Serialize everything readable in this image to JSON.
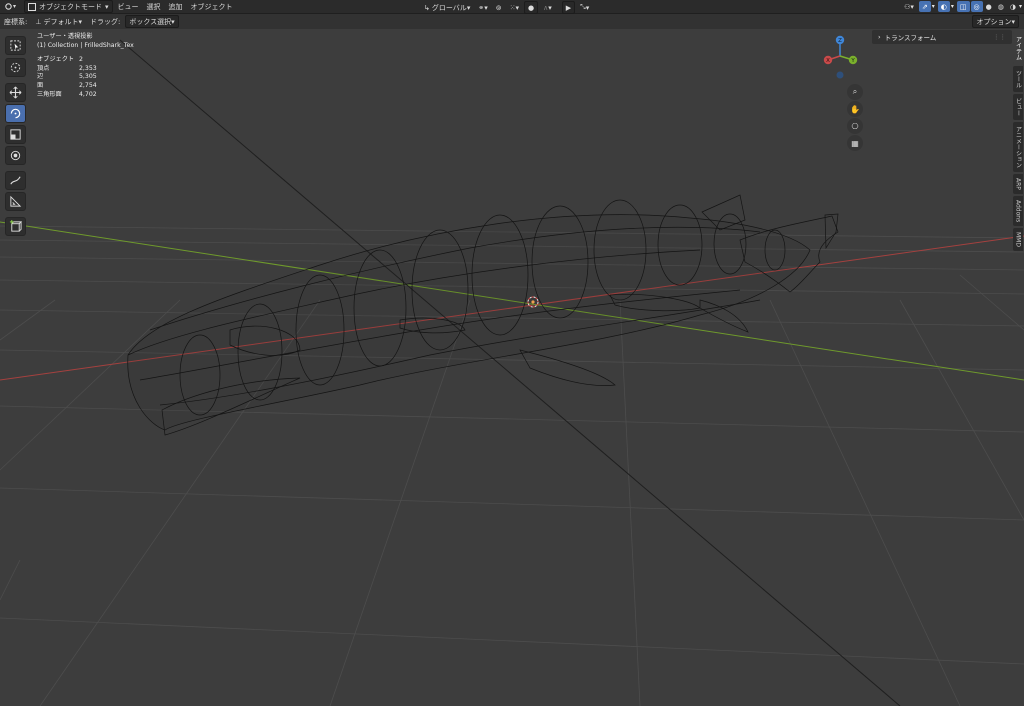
{
  "header": {
    "mode": "オブジェクトモード",
    "menus": [
      "ビュー",
      "選択",
      "追加",
      "オブジェクト"
    ],
    "transform_orientation": "グローバル"
  },
  "subheader": {
    "orientation_label": "座標系:",
    "orientation_value": "デフォルト",
    "drag_label": "ドラッグ:",
    "drag_value": "ボックス選択",
    "options": "オプション"
  },
  "overlay": {
    "view_name": "ユーザー・透視投影",
    "collection": "(1) Collection | FrilledShark_Tex",
    "stats": [
      {
        "label": "オブジェクト",
        "value": "2"
      },
      {
        "label": "頂点",
        "value": "2,353"
      },
      {
        "label": "辺",
        "value": "5,305"
      },
      {
        "label": "面",
        "value": "2,754"
      },
      {
        "label": "三角形面",
        "value": "4,702"
      }
    ]
  },
  "gizmo": {
    "x": "X",
    "y": "Y",
    "z": "Z"
  },
  "n_panel": {
    "transform_header": "トランスフォーム",
    "tabs": [
      "アイテム",
      "ツール",
      "ビュー",
      "アニメーション",
      "ARP",
      "Addons",
      "MMD"
    ]
  },
  "colors": {
    "x_axis": "#c94a4a",
    "y_axis": "#7ab02c",
    "z_axis": "#3f86d8",
    "active": "#4772b3"
  }
}
